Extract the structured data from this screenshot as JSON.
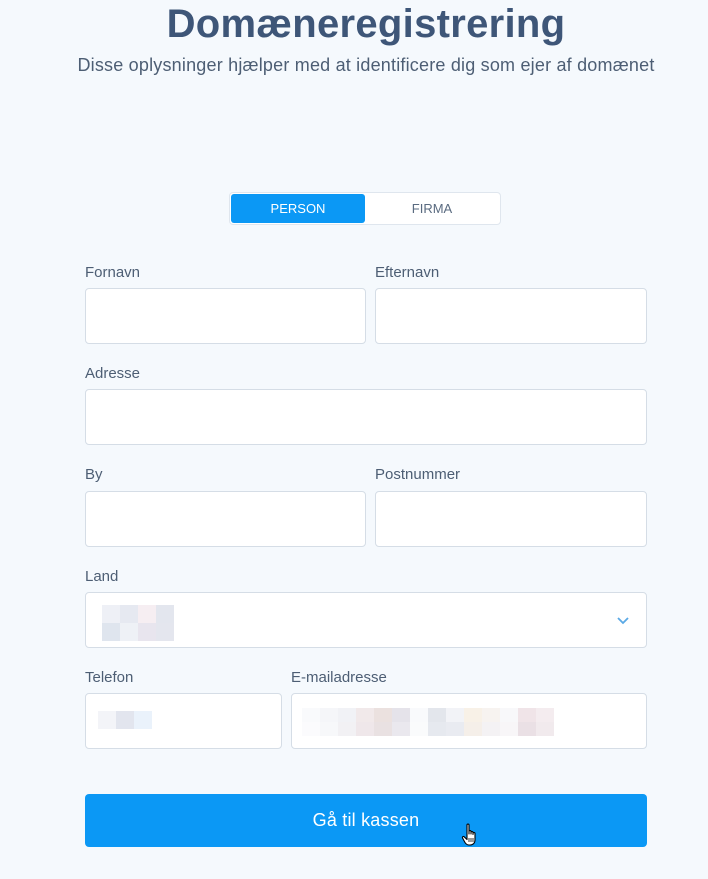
{
  "header": {
    "title": "Domæneregistrering",
    "subtitle": "Disse oplysninger hjælper med at identificere dig som ejer af domænet"
  },
  "toggle": {
    "options": [
      {
        "label": "PERSON",
        "active": true
      },
      {
        "label": "FIRMA",
        "active": false
      }
    ]
  },
  "form": {
    "first_name": {
      "label": "Fornavn",
      "value": ""
    },
    "last_name": {
      "label": "Efternavn",
      "value": ""
    },
    "address": {
      "label": "Adresse",
      "value": ""
    },
    "city": {
      "label": "By",
      "value": ""
    },
    "postal_code": {
      "label": "Postnummer",
      "value": ""
    },
    "country": {
      "label": "Land"
    },
    "phone": {
      "label": "Telefon"
    },
    "email": {
      "label": "E-mailadresse"
    }
  },
  "submit": {
    "label": "Gå til kassen"
  },
  "colors": {
    "accent": "#0b98f5",
    "title": "#3e5678",
    "background": "#f5f9fd",
    "border": "#d5dde6"
  },
  "icons": {
    "country_dropdown": "chevron-down-icon",
    "cursor": "hand-pointer-icon"
  }
}
